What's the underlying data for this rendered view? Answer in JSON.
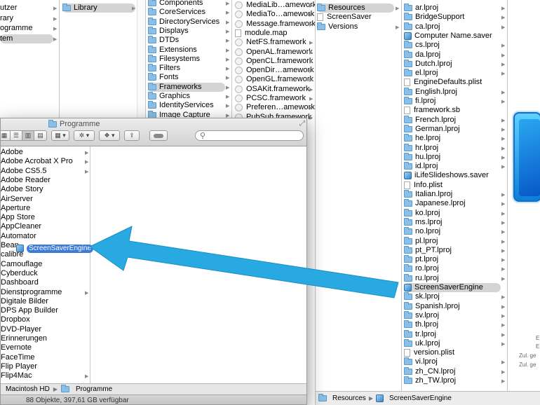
{
  "colors": {
    "arrow": "#29a9e1",
    "selection": "#d4d4d4",
    "drag_highlight": "#3d7bd8"
  },
  "bg_window": {
    "col0": [
      {
        "label": "utzer",
        "arrow": true
      },
      {
        "label": "rary",
        "arrow": true
      },
      {
        "label": "ogramme",
        "arrow": true
      },
      {
        "label": "tem",
        "arrow": true,
        "selected": true
      }
    ],
    "col1": [
      {
        "label": "Library",
        "icon": "folder-icon",
        "arrow": true,
        "selected": true
      }
    ],
    "col2": [
      {
        "label": "Components",
        "icon": "folder-icon",
        "arrow": true
      },
      {
        "label": "CoreServices",
        "icon": "folder-icon",
        "arrow": true
      },
      {
        "label": "DirectoryServices",
        "icon": "folder-icon",
        "arrow": true
      },
      {
        "label": "Displays",
        "icon": "folder-icon",
        "arrow": true
      },
      {
        "label": "DTDs",
        "icon": "folder-icon",
        "arrow": true
      },
      {
        "label": "Extensions",
        "icon": "folder-icon",
        "arrow": true
      },
      {
        "label": "Filesystems",
        "icon": "folder-icon",
        "arrow": true
      },
      {
        "label": "Filters",
        "icon": "folder-icon",
        "arrow": true
      },
      {
        "label": "Fonts",
        "icon": "folder-icon",
        "arrow": true
      },
      {
        "label": "Frameworks",
        "icon": "folder-icon",
        "arrow": true,
        "selected": true
      },
      {
        "label": "Graphics",
        "icon": "folder-icon",
        "arrow": true
      },
      {
        "label": "IdentityServices",
        "icon": "folder-icon",
        "arrow": true
      },
      {
        "label": "Image Capture",
        "icon": "folder-icon",
        "arrow": true
      }
    ],
    "col3": [
      {
        "label": "MediaLib…amework",
        "icon": "bundle-icon",
        "arrow": true
      },
      {
        "label": "MediaTo…amework",
        "icon": "bundle-icon",
        "arrow": true
      },
      {
        "label": "Message.framework",
        "icon": "bundle-icon",
        "arrow": true
      },
      {
        "label": "module.map",
        "icon": "document-icon",
        "arrow": false
      },
      {
        "label": "NetFS.framework",
        "icon": "bundle-icon",
        "arrow": true
      },
      {
        "label": "OpenAL.framework",
        "icon": "bundle-icon",
        "arrow": true
      },
      {
        "label": "OpenCL.framework",
        "icon": "bundle-icon",
        "arrow": true
      },
      {
        "label": "OpenDir…amework",
        "icon": "bundle-icon",
        "arrow": true
      },
      {
        "label": "OpenGL.framework",
        "icon": "bundle-icon",
        "arrow": true
      },
      {
        "label": "OSAKit.framework",
        "icon": "bundle-icon",
        "arrow": true
      },
      {
        "label": "PCSC.framework",
        "icon": "bundle-icon",
        "arrow": true
      },
      {
        "label": "Preferen…amework",
        "icon": "bundle-icon",
        "arrow": true
      },
      {
        "label": "PubSub.framework",
        "icon": "bundle-icon",
        "arrow": true
      }
    ],
    "col4": [
      {
        "label": "Resources",
        "icon": "folder-icon",
        "arrow": true,
        "selected": true
      },
      {
        "label": "ScreenSaver",
        "icon": "document-icon",
        "arrow": false
      },
      {
        "label": "Versions",
        "icon": "folder-icon",
        "arrow": true
      }
    ],
    "col5": [
      {
        "label": "ar.lproj",
        "icon": "folder-icon",
        "arrow": true
      },
      {
        "label": "BridgeSupport",
        "icon": "folder-icon",
        "arrow": true
      },
      {
        "label": "ca.lproj",
        "icon": "folder-icon",
        "arrow": true
      },
      {
        "label": "Computer Name.saver",
        "icon": "saver-icon",
        "arrow": false
      },
      {
        "label": "cs.lproj",
        "icon": "folder-icon",
        "arrow": true
      },
      {
        "label": "da.lproj",
        "icon": "folder-icon",
        "arrow": true
      },
      {
        "label": "Dutch.lproj",
        "icon": "folder-icon",
        "arrow": true
      },
      {
        "label": "el.lproj",
        "icon": "folder-icon",
        "arrow": true
      },
      {
        "label": "EngineDefaults.plist",
        "icon": "document-icon",
        "arrow": false
      },
      {
        "label": "English.lproj",
        "icon": "folder-icon",
        "arrow": true
      },
      {
        "label": "fi.lproj",
        "icon": "folder-icon",
        "arrow": true
      },
      {
        "label": "framework.sb",
        "icon": "document-icon",
        "arrow": false
      },
      {
        "label": "French.lproj",
        "icon": "folder-icon",
        "arrow": true
      },
      {
        "label": "German.lproj",
        "icon": "folder-icon",
        "arrow": true
      },
      {
        "label": "he.lproj",
        "icon": "folder-icon",
        "arrow": true
      },
      {
        "label": "hr.lproj",
        "icon": "folder-icon",
        "arrow": true
      },
      {
        "label": "hu.lproj",
        "icon": "folder-icon",
        "arrow": true
      },
      {
        "label": "id.lproj",
        "icon": "folder-icon",
        "arrow": true
      },
      {
        "label": "iLifeSlideshows.saver",
        "icon": "saver-icon",
        "arrow": false
      },
      {
        "label": "Info.plist",
        "icon": "document-icon",
        "arrow": false
      },
      {
        "label": "Italian.lproj",
        "icon": "folder-icon",
        "arrow": true
      },
      {
        "label": "Japanese.lproj",
        "icon": "folder-icon",
        "arrow": true
      },
      {
        "label": "ko.lproj",
        "icon": "folder-icon",
        "arrow": true
      },
      {
        "label": "ms.lproj",
        "icon": "folder-icon",
        "arrow": true
      },
      {
        "label": "no.lproj",
        "icon": "folder-icon",
        "arrow": true
      },
      {
        "label": "pl.lproj",
        "icon": "folder-icon",
        "arrow": true
      },
      {
        "label": "pt_PT.lproj",
        "icon": "folder-icon",
        "arrow": true
      },
      {
        "label": "pt.lproj",
        "icon": "folder-icon",
        "arrow": true
      },
      {
        "label": "ro.lproj",
        "icon": "folder-icon",
        "arrow": true
      },
      {
        "label": "ru.lproj",
        "icon": "folder-icon",
        "arrow": true
      },
      {
        "label": "ScreenSaverEngine",
        "icon": "saver-icon",
        "arrow": false,
        "selected": true
      },
      {
        "label": "sk.lproj",
        "icon": "folder-icon",
        "arrow": true
      },
      {
        "label": "Spanish.lproj",
        "icon": "folder-icon",
        "arrow": true
      },
      {
        "label": "sv.lproj",
        "icon": "folder-icon",
        "arrow": true
      },
      {
        "label": "th.lproj",
        "icon": "folder-icon",
        "arrow": true
      },
      {
        "label": "tr.lproj",
        "icon": "folder-icon",
        "arrow": true
      },
      {
        "label": "uk.lproj",
        "icon": "folder-icon",
        "arrow": true
      },
      {
        "label": "version.plist",
        "icon": "document-icon",
        "arrow": false
      },
      {
        "label": "vi.lproj",
        "icon": "folder-icon",
        "arrow": true
      },
      {
        "label": "zh_CN.lproj",
        "icon": "folder-icon",
        "arrow": true
      },
      {
        "label": "zh_TW.lproj",
        "icon": "folder-icon",
        "arrow": true
      }
    ],
    "preview_info": [
      "E",
      "E",
      "Zul. ge",
      "Zul. ge"
    ],
    "path_bar": {
      "segment1": "Resources",
      "segment2": "ScreenSaverEngine"
    }
  },
  "front_window": {
    "title": "Programme",
    "search_placeholder": "",
    "items": [
      {
        "label": "Adobe",
        "arrow": true
      },
      {
        "label": "Adobe Acrobat X Pro",
        "arrow": true
      },
      {
        "label": "Adobe CS5.5",
        "arrow": true
      },
      {
        "label": "Adobe Reader",
        "arrow": false
      },
      {
        "label": "Adobe Story",
        "arrow": false
      },
      {
        "label": "AirServer",
        "arrow": false
      },
      {
        "label": "Aperture",
        "arrow": false
      },
      {
        "label": "App Store",
        "arrow": false
      },
      {
        "label": "AppCleaner",
        "arrow": false
      },
      {
        "label": "Automator",
        "arrow": false
      },
      {
        "label": "Bean",
        "arrow": false
      },
      {
        "label": "calibre",
        "arrow": false
      },
      {
        "label": "Camouflage",
        "arrow": false
      },
      {
        "label": "Cyberduck",
        "arrow": false
      },
      {
        "label": "Dashboard",
        "arrow": false
      },
      {
        "label": "Dienstprogramme",
        "arrow": true
      },
      {
        "label": "Digitale Bilder",
        "arrow": false
      },
      {
        "label": "DPS App Builder",
        "arrow": false
      },
      {
        "label": "Dropbox",
        "arrow": false
      },
      {
        "label": "DVD-Player",
        "arrow": false
      },
      {
        "label": "Erinnerungen",
        "arrow": false
      },
      {
        "label": "Evernote",
        "arrow": false
      },
      {
        "label": "FaceTime",
        "arrow": false
      },
      {
        "label": "Flip Player",
        "arrow": false
      },
      {
        "label": "Flip4Mac",
        "arrow": true
      }
    ],
    "dragged_item": "ScreenSaverEngine",
    "path_bar": {
      "segment1": "Macintosh HD",
      "segment2": "Programme"
    },
    "status": "88 Objekte, 397,61 GB verfügbar"
  }
}
